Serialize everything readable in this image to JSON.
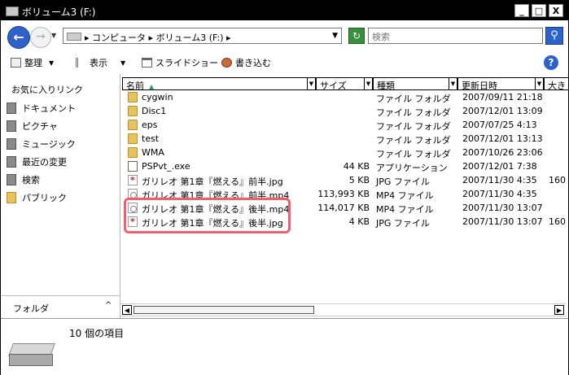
{
  "window": {
    "title": "ボリューム3 (F:)",
    "minimize": "_",
    "maximize": "□",
    "close": "X"
  },
  "address": {
    "crumb_computer": "コンピュータ",
    "crumb_volume": "ボリューム3 (F:)",
    "separator": "▸",
    "search_placeholder": "検索"
  },
  "toolbar": {
    "organize": "整理",
    "view": "表示",
    "slideshow": "スライドショー",
    "burn": "書き込む",
    "help": "?"
  },
  "nav": {
    "favorites_title": "お気に入りリンク",
    "items": [
      {
        "label": "ドキュメント",
        "icon": "documents-icon"
      },
      {
        "label": "ピクチャ",
        "icon": "pictures-icon"
      },
      {
        "label": "ミュージック",
        "icon": "music-icon"
      },
      {
        "label": "最近の変更",
        "icon": "recent-icon"
      },
      {
        "label": "検索",
        "icon": "search-folder-icon"
      },
      {
        "label": "パブリック",
        "icon": "public-folder-icon"
      }
    ],
    "folders_label": "フォルダ",
    "folders_chevron": "^"
  },
  "columns": {
    "name": "名前",
    "size": "サイズ",
    "type": "種類",
    "modified": "更新日時",
    "extra": "大き"
  },
  "files": [
    {
      "name": "cygwin",
      "size": "",
      "type": "ファイル フォルダ",
      "modified": "2007/09/11 21:18",
      "extra": "",
      "kind": "folder"
    },
    {
      "name": "Disc1",
      "size": "",
      "type": "ファイル フォルダ",
      "modified": "2007/12/01 13:09",
      "extra": "",
      "kind": "folder"
    },
    {
      "name": "eps",
      "size": "",
      "type": "ファイル フォルダ",
      "modified": "2007/07/25 4:13",
      "extra": "",
      "kind": "folder"
    },
    {
      "name": "test",
      "size": "",
      "type": "ファイル フォルダ",
      "modified": "2007/12/01 13:13",
      "extra": "",
      "kind": "folder"
    },
    {
      "name": "WMA",
      "size": "",
      "type": "ファイル フォルダ",
      "modified": "2007/10/26 23:06",
      "extra": "",
      "kind": "folder"
    },
    {
      "name": "PSPvt_.exe",
      "size": "44 KB",
      "type": "アプリケーション",
      "modified": "2007/12/01 7:38",
      "extra": "",
      "kind": "app"
    },
    {
      "name": "ガリレオ 第1章『燃える』前半.jpg",
      "size": "5 KB",
      "type": "JPG ファイル",
      "modified": "2007/11/30 4:35",
      "extra": "160",
      "kind": "jpg"
    },
    {
      "name": "ガリレオ 第1章『燃える』前半.mp4",
      "size": "113,993 KB",
      "type": "MP4 ファイル",
      "modified": "2007/11/30 4:35",
      "extra": "",
      "kind": "mp4"
    },
    {
      "name": "ガリレオ 第1章『燃える』後半.mp4",
      "size": "114,017 KB",
      "type": "MP4 ファイル",
      "modified": "2007/11/30 13:07",
      "extra": "",
      "kind": "mp4"
    },
    {
      "name": "ガリレオ 第1章『燃える』後半.jpg",
      "size": "4 KB",
      "type": "JPG ファイル",
      "modified": "2007/11/30 13:07",
      "extra": "160",
      "kind": "jpg"
    }
  ],
  "status": {
    "item_count": "10 個の項目"
  },
  "colors": {
    "accent": "#2e62c8",
    "highlight": "#f0606a",
    "search_text": "#3a9a3a"
  }
}
